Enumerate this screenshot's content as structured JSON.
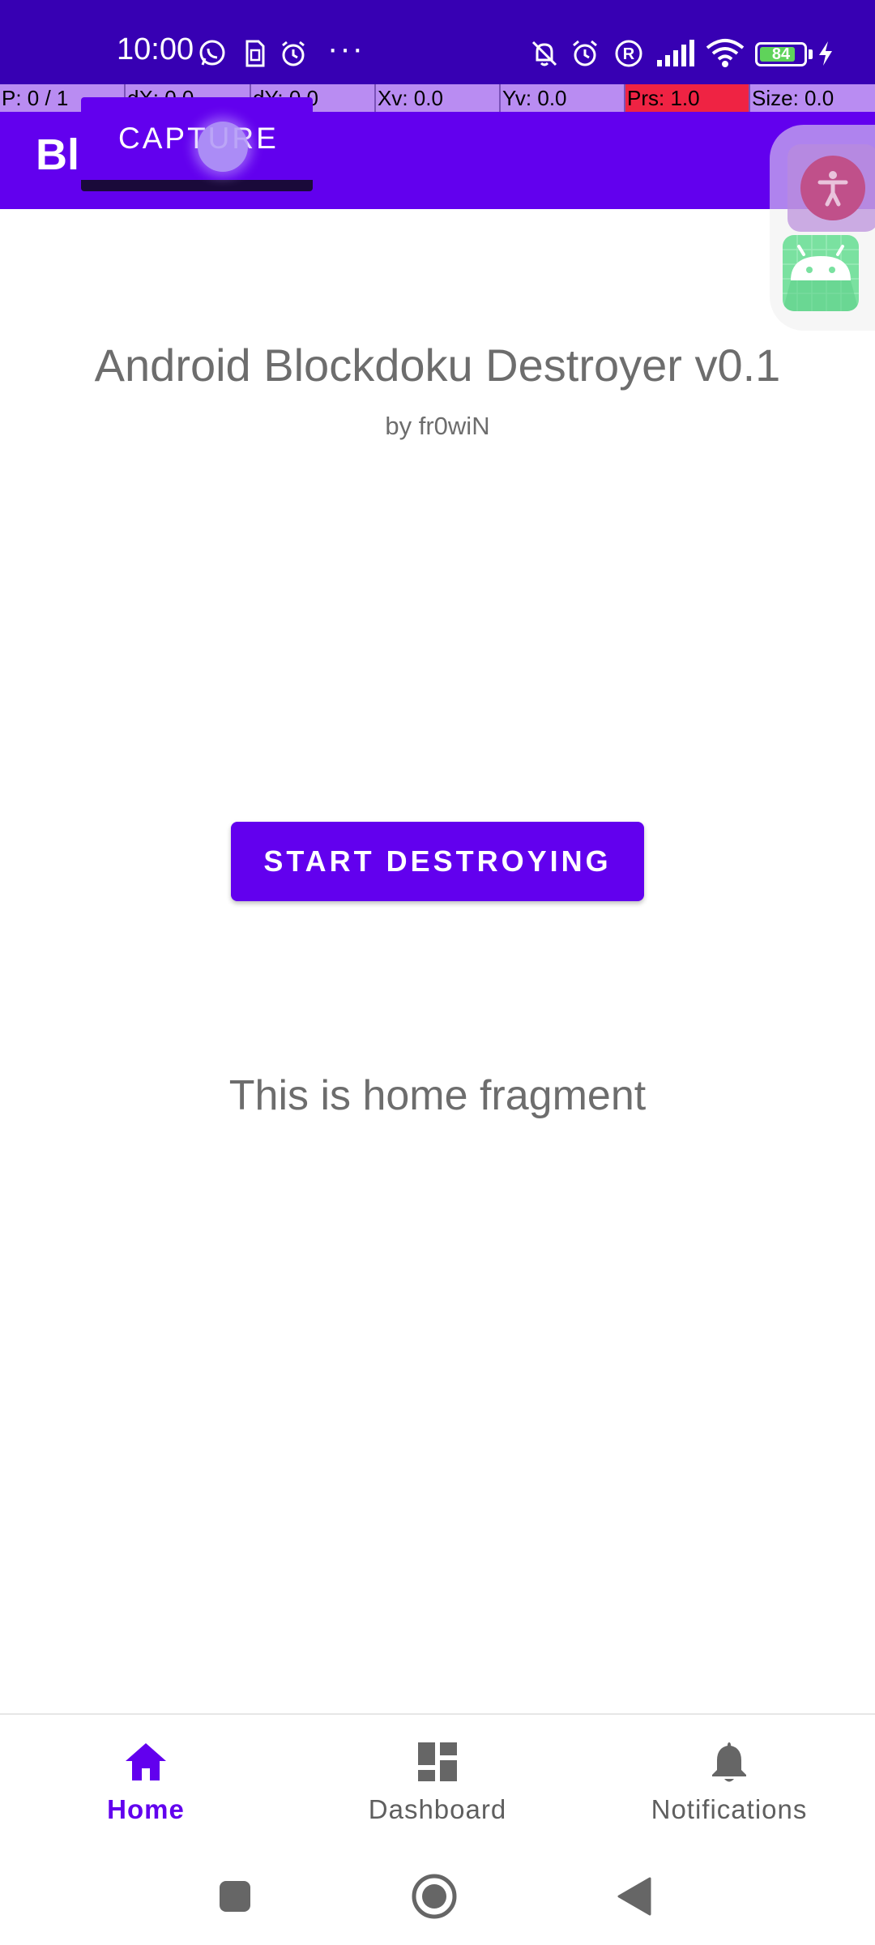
{
  "status_bar": {
    "time": "10:00",
    "icons": [
      "whatsapp-icon",
      "sim-icon",
      "alarm-clock-icon",
      "more-icon",
      "bell-off-icon",
      "alarm-icon",
      "registered-icon",
      "signal-icon",
      "wifi-icon",
      "battery-icon",
      "charging-icon"
    ],
    "overflow": "···",
    "battery_level": "84",
    "battery_fraction": 0.84
  },
  "pointer_overlay": {
    "pointers": "P: 0 / 1",
    "dx": "dX: 0.0",
    "dy": "dY: 0.0",
    "xv": "Xv: 0.0",
    "yv": "Yv: 0.0",
    "prs": "Prs: 1.0",
    "size": "Size: 0.0",
    "colors": {
      "bg": "#b98cf2",
      "prs_bg": "#ef2343"
    }
  },
  "app_bar": {
    "title": "Bl",
    "capture_label": "CAPTURE"
  },
  "main": {
    "title": "Android Blockdoku Destroyer v0.1",
    "subtitle": "by fr0wiN",
    "start_button": "START DESTROYING",
    "fragment_text": "This is home fragment"
  },
  "bottom_nav": {
    "items": [
      {
        "label": "Home",
        "icon": "home-icon",
        "active": true
      },
      {
        "label": "Dashboard",
        "icon": "dashboard-icon",
        "active": false
      },
      {
        "label": "Notifications",
        "icon": "notifications-icon",
        "active": false
      }
    ]
  },
  "system_nav": {
    "buttons": [
      "recents-icon",
      "home-circle-icon",
      "back-icon"
    ]
  },
  "theme": {
    "primary": "#6200ee",
    "primary_dark": "#3700b3",
    "text_gray": "#6d6d6d"
  }
}
